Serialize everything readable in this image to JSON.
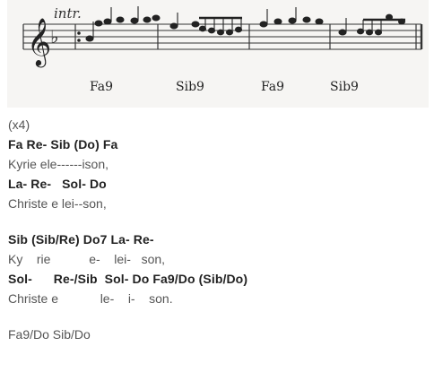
{
  "score": {
    "tempo_label": "intr.",
    "chords": [
      "Fa9",
      "Sib9",
      "Fa9",
      "Sib9"
    ]
  },
  "lyrics": {
    "repeat": "(x4)",
    "lines": [
      {
        "kind": "chord",
        "text": "Fa Re- Sib (Do) Fa"
      },
      {
        "kind": "lyric",
        "text": "Kyrie ele------ison,"
      },
      {
        "kind": "chord",
        "text": "La- Re-   Sol- Do"
      },
      {
        "kind": "lyric",
        "text": "Christe e lei--son,"
      },
      {
        "kind": "chord",
        "text": "Sib (Sib/Re) Do7 La- Re-"
      },
      {
        "kind": "lyric",
        "text": "Ky    rie           e-    lei-   son,"
      },
      {
        "kind": "chord",
        "text": "Sol-      Re-/Sib  Sol- Do Fa9/Do (Sib/Do)"
      },
      {
        "kind": "lyric",
        "text": "Christe e            le-    i-    son."
      }
    ],
    "ending": "Fa9/Do Sib/Do"
  }
}
